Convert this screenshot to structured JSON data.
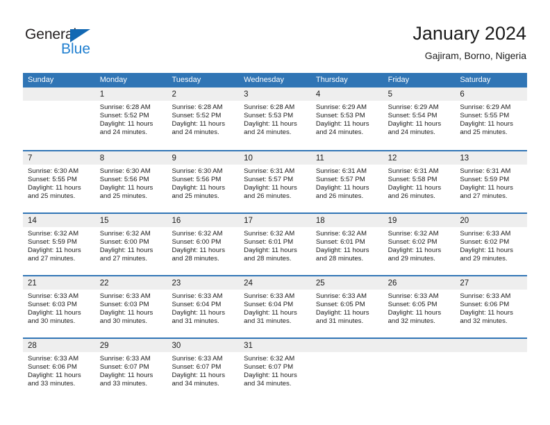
{
  "logo": {
    "word_dark": "General",
    "word_blue": "Blue",
    "triangle_color": "#1268b3",
    "blue_color": "#1f7fd0"
  },
  "header": {
    "title": "January 2024",
    "subtitle": "Gajiram, Borno, Nigeria"
  },
  "theme": {
    "header_blue": "#3075b5",
    "day_strip_gray": "#eeeeee"
  },
  "calendar": {
    "weekdays": [
      "Sunday",
      "Monday",
      "Tuesday",
      "Wednesday",
      "Thursday",
      "Friday",
      "Saturday"
    ],
    "weeks": [
      [
        {
          "day": "",
          "empty": true
        },
        {
          "day": "1",
          "sunrise": "Sunrise: 6:28 AM",
          "sunset": "Sunset: 5:52 PM",
          "daylight1": "Daylight: 11 hours",
          "daylight2": "and 24 minutes."
        },
        {
          "day": "2",
          "sunrise": "Sunrise: 6:28 AM",
          "sunset": "Sunset: 5:52 PM",
          "daylight1": "Daylight: 11 hours",
          "daylight2": "and 24 minutes."
        },
        {
          "day": "3",
          "sunrise": "Sunrise: 6:28 AM",
          "sunset": "Sunset: 5:53 PM",
          "daylight1": "Daylight: 11 hours",
          "daylight2": "and 24 minutes."
        },
        {
          "day": "4",
          "sunrise": "Sunrise: 6:29 AM",
          "sunset": "Sunset: 5:53 PM",
          "daylight1": "Daylight: 11 hours",
          "daylight2": "and 24 minutes."
        },
        {
          "day": "5",
          "sunrise": "Sunrise: 6:29 AM",
          "sunset": "Sunset: 5:54 PM",
          "daylight1": "Daylight: 11 hours",
          "daylight2": "and 24 minutes."
        },
        {
          "day": "6",
          "sunrise": "Sunrise: 6:29 AM",
          "sunset": "Sunset: 5:55 PM",
          "daylight1": "Daylight: 11 hours",
          "daylight2": "and 25 minutes."
        }
      ],
      [
        {
          "day": "7",
          "sunrise": "Sunrise: 6:30 AM",
          "sunset": "Sunset: 5:55 PM",
          "daylight1": "Daylight: 11 hours",
          "daylight2": "and 25 minutes."
        },
        {
          "day": "8",
          "sunrise": "Sunrise: 6:30 AM",
          "sunset": "Sunset: 5:56 PM",
          "daylight1": "Daylight: 11 hours",
          "daylight2": "and 25 minutes."
        },
        {
          "day": "9",
          "sunrise": "Sunrise: 6:30 AM",
          "sunset": "Sunset: 5:56 PM",
          "daylight1": "Daylight: 11 hours",
          "daylight2": "and 25 minutes."
        },
        {
          "day": "10",
          "sunrise": "Sunrise: 6:31 AM",
          "sunset": "Sunset: 5:57 PM",
          "daylight1": "Daylight: 11 hours",
          "daylight2": "and 26 minutes."
        },
        {
          "day": "11",
          "sunrise": "Sunrise: 6:31 AM",
          "sunset": "Sunset: 5:57 PM",
          "daylight1": "Daylight: 11 hours",
          "daylight2": "and 26 minutes."
        },
        {
          "day": "12",
          "sunrise": "Sunrise: 6:31 AM",
          "sunset": "Sunset: 5:58 PM",
          "daylight1": "Daylight: 11 hours",
          "daylight2": "and 26 minutes."
        },
        {
          "day": "13",
          "sunrise": "Sunrise: 6:31 AM",
          "sunset": "Sunset: 5:59 PM",
          "daylight1": "Daylight: 11 hours",
          "daylight2": "and 27 minutes."
        }
      ],
      [
        {
          "day": "14",
          "sunrise": "Sunrise: 6:32 AM",
          "sunset": "Sunset: 5:59 PM",
          "daylight1": "Daylight: 11 hours",
          "daylight2": "and 27 minutes."
        },
        {
          "day": "15",
          "sunrise": "Sunrise: 6:32 AM",
          "sunset": "Sunset: 6:00 PM",
          "daylight1": "Daylight: 11 hours",
          "daylight2": "and 27 minutes."
        },
        {
          "day": "16",
          "sunrise": "Sunrise: 6:32 AM",
          "sunset": "Sunset: 6:00 PM",
          "daylight1": "Daylight: 11 hours",
          "daylight2": "and 28 minutes."
        },
        {
          "day": "17",
          "sunrise": "Sunrise: 6:32 AM",
          "sunset": "Sunset: 6:01 PM",
          "daylight1": "Daylight: 11 hours",
          "daylight2": "and 28 minutes."
        },
        {
          "day": "18",
          "sunrise": "Sunrise: 6:32 AM",
          "sunset": "Sunset: 6:01 PM",
          "daylight1": "Daylight: 11 hours",
          "daylight2": "and 28 minutes."
        },
        {
          "day": "19",
          "sunrise": "Sunrise: 6:32 AM",
          "sunset": "Sunset: 6:02 PM",
          "daylight1": "Daylight: 11 hours",
          "daylight2": "and 29 minutes."
        },
        {
          "day": "20",
          "sunrise": "Sunrise: 6:33 AM",
          "sunset": "Sunset: 6:02 PM",
          "daylight1": "Daylight: 11 hours",
          "daylight2": "and 29 minutes."
        }
      ],
      [
        {
          "day": "21",
          "sunrise": "Sunrise: 6:33 AM",
          "sunset": "Sunset: 6:03 PM",
          "daylight1": "Daylight: 11 hours",
          "daylight2": "and 30 minutes."
        },
        {
          "day": "22",
          "sunrise": "Sunrise: 6:33 AM",
          "sunset": "Sunset: 6:03 PM",
          "daylight1": "Daylight: 11 hours",
          "daylight2": "and 30 minutes."
        },
        {
          "day": "23",
          "sunrise": "Sunrise: 6:33 AM",
          "sunset": "Sunset: 6:04 PM",
          "daylight1": "Daylight: 11 hours",
          "daylight2": "and 31 minutes."
        },
        {
          "day": "24",
          "sunrise": "Sunrise: 6:33 AM",
          "sunset": "Sunset: 6:04 PM",
          "daylight1": "Daylight: 11 hours",
          "daylight2": "and 31 minutes."
        },
        {
          "day": "25",
          "sunrise": "Sunrise: 6:33 AM",
          "sunset": "Sunset: 6:05 PM",
          "daylight1": "Daylight: 11 hours",
          "daylight2": "and 31 minutes."
        },
        {
          "day": "26",
          "sunrise": "Sunrise: 6:33 AM",
          "sunset": "Sunset: 6:05 PM",
          "daylight1": "Daylight: 11 hours",
          "daylight2": "and 32 minutes."
        },
        {
          "day": "27",
          "sunrise": "Sunrise: 6:33 AM",
          "sunset": "Sunset: 6:06 PM",
          "daylight1": "Daylight: 11 hours",
          "daylight2": "and 32 minutes."
        }
      ],
      [
        {
          "day": "28",
          "sunrise": "Sunrise: 6:33 AM",
          "sunset": "Sunset: 6:06 PM",
          "daylight1": "Daylight: 11 hours",
          "daylight2": "and 33 minutes."
        },
        {
          "day": "29",
          "sunrise": "Sunrise: 6:33 AM",
          "sunset": "Sunset: 6:07 PM",
          "daylight1": "Daylight: 11 hours",
          "daylight2": "and 33 minutes."
        },
        {
          "day": "30",
          "sunrise": "Sunrise: 6:33 AM",
          "sunset": "Sunset: 6:07 PM",
          "daylight1": "Daylight: 11 hours",
          "daylight2": "and 34 minutes."
        },
        {
          "day": "31",
          "sunrise": "Sunrise: 6:32 AM",
          "sunset": "Sunset: 6:07 PM",
          "daylight1": "Daylight: 11 hours",
          "daylight2": "and 34 minutes."
        },
        {
          "day": "",
          "empty": true
        },
        {
          "day": "",
          "empty": true
        },
        {
          "day": "",
          "empty": true
        }
      ]
    ]
  }
}
